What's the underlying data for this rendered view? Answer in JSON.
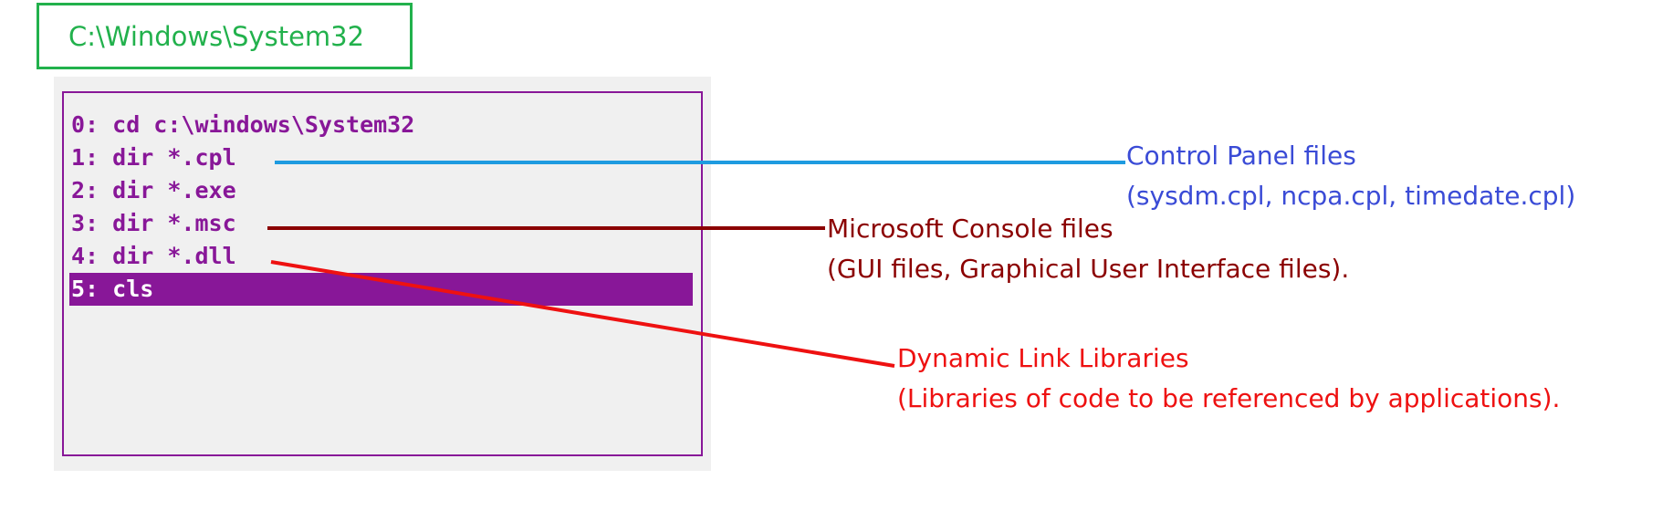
{
  "path_label": "C:\\Windows\\System32",
  "history": [
    {
      "text": "0: cd c:\\windows\\System32",
      "selected": false
    },
    {
      "text": "1: dir *.cpl",
      "selected": false
    },
    {
      "text": "2: dir *.exe",
      "selected": false
    },
    {
      "text": "3: dir *.msc",
      "selected": false
    },
    {
      "text": "4: dir *.dll",
      "selected": false
    },
    {
      "text": "5: cls",
      "selected": true
    }
  ],
  "annotations": {
    "cpl": {
      "title": "Control Panel files",
      "detail": "(sysdm.cpl, ncpa.cpl, timedate.cpl)",
      "color": "#3a4bd6",
      "line_color": "#1e9be0"
    },
    "msc": {
      "title": "Microsoft Console files",
      "detail": "(GUI files,  Graphical User Interface files).",
      "color": "#8b0000",
      "line_color": "#8b0000"
    },
    "dll": {
      "title": "Dynamic Link Libraries",
      "detail": "(Libraries of code to be referenced by applications).",
      "color": "#ee1111",
      "line_color": "#ee1111"
    }
  },
  "colors": {
    "path_green": "#22b14c",
    "console_purple": "#881798",
    "console_bg": "#f0f0f0"
  }
}
